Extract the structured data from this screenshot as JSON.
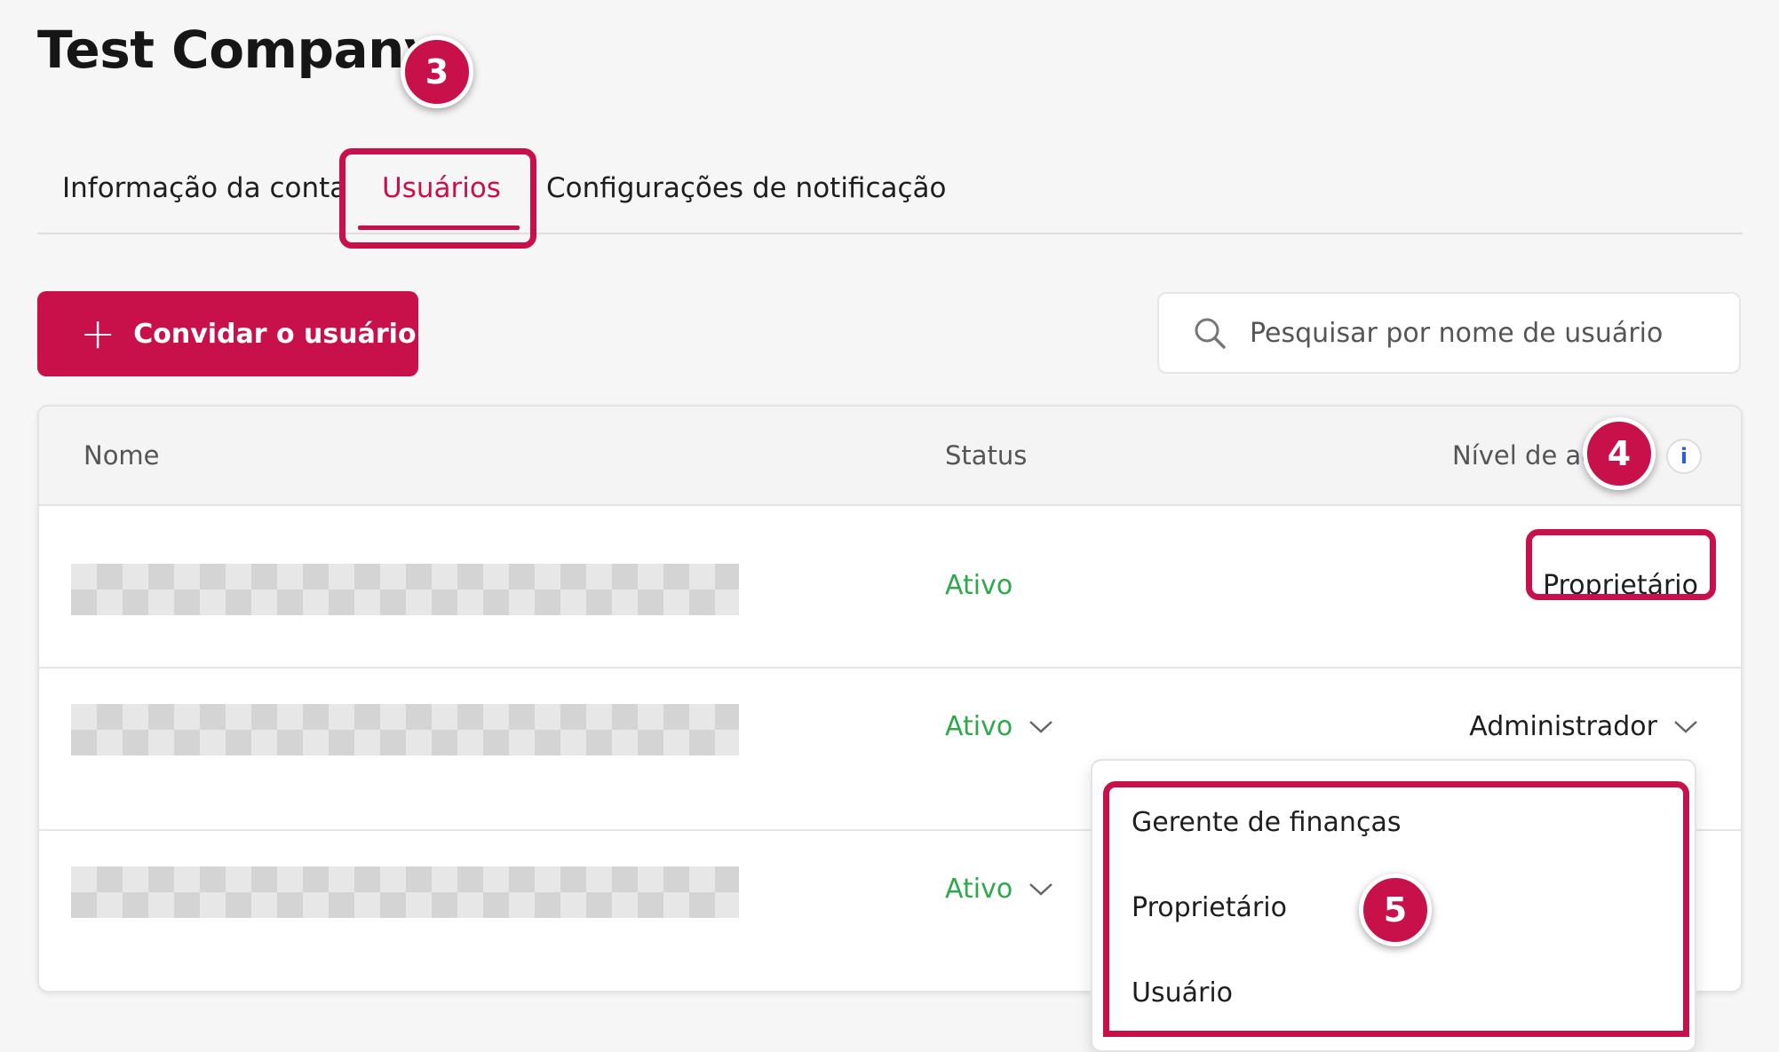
{
  "page": {
    "title": "Test Company"
  },
  "tabs": [
    {
      "label": "Informação da conta",
      "active": false
    },
    {
      "label": "Usuários",
      "active": true
    },
    {
      "label": "Configurações de notificação",
      "active": false
    }
  ],
  "toolbar": {
    "invite_label": "Convidar o usuário",
    "search_placeholder": "Pesquisar por nome de usuário"
  },
  "table": {
    "headers": {
      "name": "Nome",
      "status": "Status",
      "access_level": "Nível de ac"
    },
    "rows": [
      {
        "status": "Ativo",
        "role": "Proprietário",
        "has_status_dropdown": false,
        "has_role_dropdown": false
      },
      {
        "status": "Ativo",
        "role": "Administrador",
        "has_status_dropdown": true,
        "has_role_dropdown": true
      },
      {
        "status": "Ativo",
        "role": "",
        "has_status_dropdown": true,
        "has_role_dropdown": false
      }
    ]
  },
  "role_dropdown": {
    "options": [
      "Gerente de finanças",
      "Proprietário",
      "Usuário"
    ]
  },
  "annotations": {
    "step_3": "3",
    "step_4": "4",
    "step_5": "5"
  },
  "colors": {
    "accent": "#c8104a",
    "active_status": "#2ea84a",
    "info_icon": "#2f5fd0"
  }
}
